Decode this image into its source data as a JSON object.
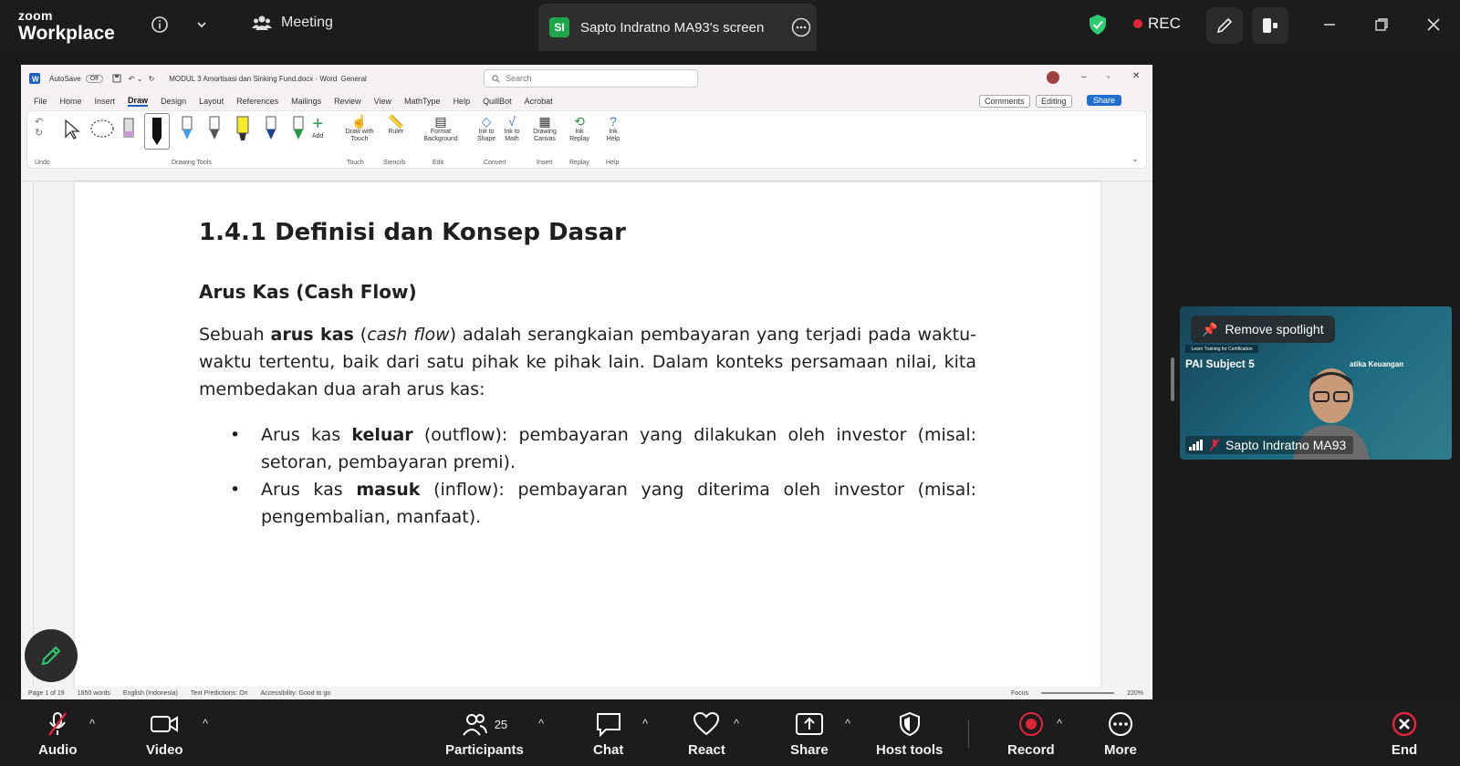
{
  "zoom": {
    "logo_line1": "zoom",
    "logo_line2": "Workplace",
    "meeting_label": "Meeting",
    "screen_tab_initials": "SI",
    "screen_tab_label": "Sapto Indratno MA93's screen",
    "rec_label": "REC",
    "rec_color": "#e0243a",
    "shield_color": "#2ecc71"
  },
  "word": {
    "autosave_label": "AutoSave",
    "autosave_state": "Off",
    "doc_title": "MODUL 3 Amortisasi dan Sinking Fund.docx · Word",
    "sensitivity": "General",
    "search_placeholder": "Search",
    "menus": [
      "File",
      "Home",
      "Insert",
      "Draw",
      "Design",
      "Layout",
      "References",
      "Mailings",
      "Review",
      "View",
      "MathType",
      "Help",
      "QuillBot",
      "Acrobat"
    ],
    "comments_label": "Comments",
    "editing_label": "Editing",
    "share_label": "Share",
    "ribbon_tools": {
      "add": "Add",
      "draw_with_touch": "Draw with Touch",
      "ruler": "Ruler",
      "format_background": "Format Background",
      "ink_to_shape": "Ink to Shape",
      "ink_to_math": "Ink to Math",
      "drawing_canvas": "Drawing Canvas",
      "ink_replay": "Ink Replay",
      "ink_help": "Ink Help"
    },
    "ribbon_groups": {
      "undo": "Undo",
      "drawing_tools": "Drawing Tools",
      "touch": "Touch",
      "stencils": "Stencils",
      "edit": "Edit",
      "convert": "Convert",
      "insert": "Insert",
      "replay": "Replay",
      "help": "Help"
    },
    "heading1": "1.4.1 Definisi dan Konsep Dasar",
    "heading2": "Arus Kas (Cash Flow)",
    "para_1": "Sebuah ",
    "para_bold": "arus kas",
    "para_2": " (",
    "para_italic": "cash flow",
    "para_3": ") adalah serangkaian pembayaran yang terjadi pada waktu-waktu tertentu, baik dari satu pihak ke pihak lain. Dalam konteks persamaan nilai, kita membedakan dua arah arus kas:",
    "bullets": [
      {
        "pre": "Arus kas ",
        "bold": "keluar",
        "post": " (outflow): pembayaran yang dilakukan oleh investor (misal: setoran, pembayaran premi)."
      },
      {
        "pre": "Arus kas ",
        "bold": "masuk",
        "post": " (inflow): pembayaran yang diterima oleh investor (misal: pengembalian, manfaat)."
      }
    ],
    "status": {
      "page": "Page 1 of 19",
      "words": "1850 words",
      "language": "English (Indonesia)",
      "predictions": "Text Predictions: On",
      "accessibility": "Accessibility: Good to go",
      "focus": "Focus",
      "zoom": "220%"
    }
  },
  "video": {
    "spotlight_label": "Remove spotlight",
    "participant_name": "Sapto Indratno MA93",
    "slide_tag": "Learn Training for Certification",
    "slide_title": "PAI Subject 5",
    "slide_subtitle": "atika Keuangan"
  },
  "toolbar": {
    "audio": "Audio",
    "video": "Video",
    "participants": "Participants",
    "participants_count": "25",
    "chat": "Chat",
    "react": "React",
    "share": "Share",
    "host_tools": "Host tools",
    "record": "Record",
    "more": "More",
    "end": "End"
  }
}
